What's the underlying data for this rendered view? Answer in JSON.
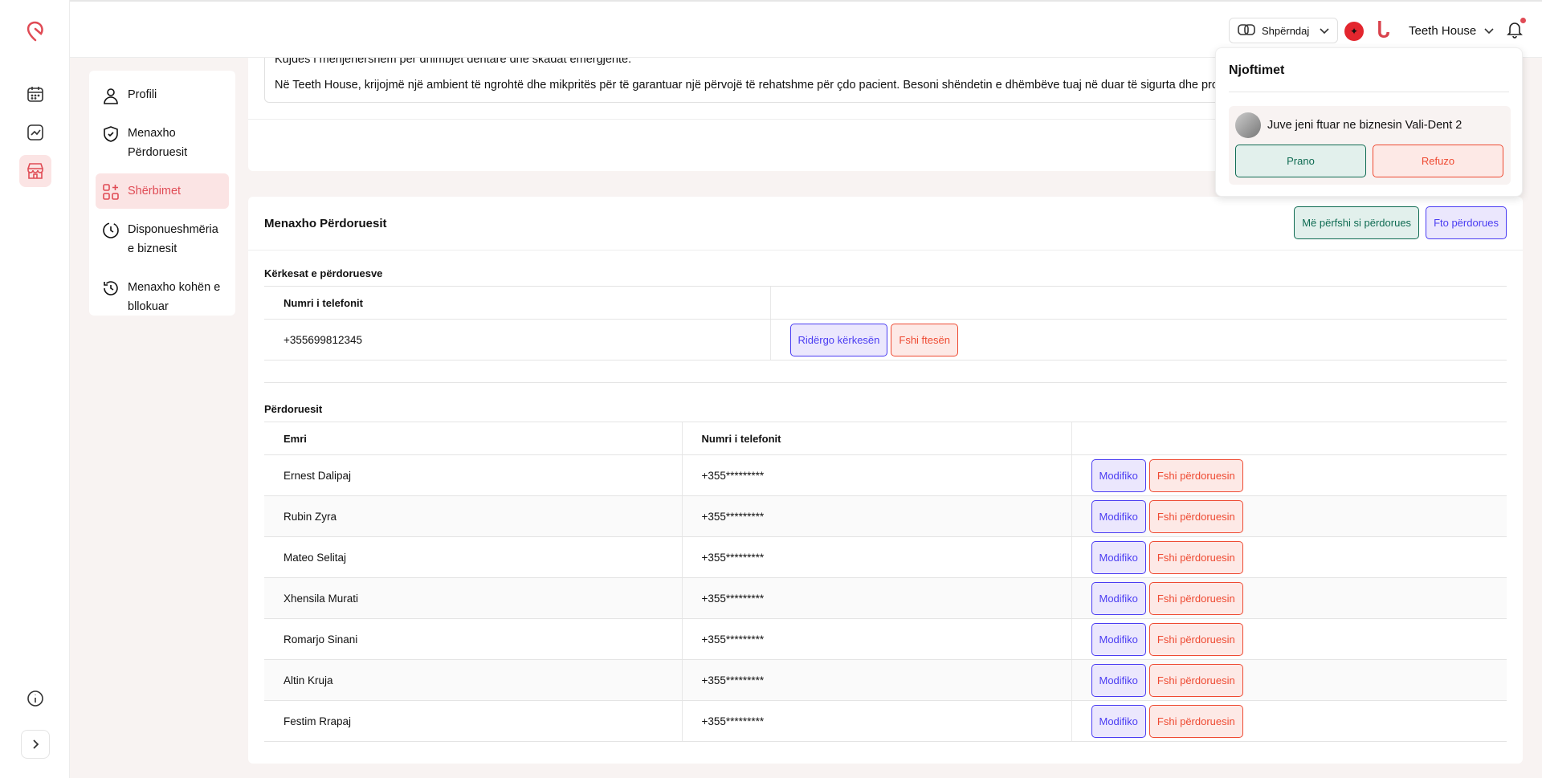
{
  "header": {
    "share_label": "Shpërndaj",
    "business_name": "Teeth House"
  },
  "rail": {
    "icons": [
      "calendar-icon",
      "chart-icon",
      "store-icon",
      "info-icon",
      "chevron-right-icon"
    ]
  },
  "menu": {
    "items": [
      {
        "label": "Profili"
      },
      {
        "label": "Menaxho Përdoruesit"
      },
      {
        "label": "Shërbimet",
        "active": true
      },
      {
        "label": "Disponueshmëria e biznesit"
      },
      {
        "label": "Menaxho kohën e bllokuar"
      }
    ]
  },
  "description": {
    "line1": "Kujdes i menjëhershëm për dhimbjet dentare dhe skadat emergjente.",
    "line2": "Në Teeth House, krijojmë një ambient të ngrohtë dhe mikpritës për të garantuar një përvojë të rehatshme për çdo pacient. Besoni shëndetin e dhëmbëve tuaj në duar të sigurta dhe profesionale!"
  },
  "users_card": {
    "title": "Menaxho Përdoruesit",
    "include_label": "Më përfshi si përdorues",
    "invite_label": "Fto përdorues",
    "requests": {
      "title": "Kërkesat e përdoruesve",
      "col_phone": "Numri i telefonit",
      "rows": [
        {
          "phone": "+355699812345",
          "resend": "Ridërgo kërkesën",
          "delete": "Fshi ftesën"
        }
      ]
    },
    "users": {
      "title": "Përdoruesit",
      "col_name": "Emri",
      "col_phone": "Numri i telefonit",
      "edit_label": "Modifiko",
      "delete_label": "Fshi përdoruesin",
      "rows": [
        {
          "name": "Ernest Dalipaj",
          "phone": "+355*********"
        },
        {
          "name": "Rubin Zyra",
          "phone": "+355*********"
        },
        {
          "name": "Mateo Selitaj",
          "phone": "+355*********"
        },
        {
          "name": "Xhensila Murati",
          "phone": "+355*********"
        },
        {
          "name": "Romarjo Sinani",
          "phone": "+355*********"
        },
        {
          "name": "Altin Kruja",
          "phone": "+355*********"
        },
        {
          "name": "Festim Rrapaj",
          "phone": "+355*********"
        }
      ]
    }
  },
  "notifications": {
    "title": "Njoftimet",
    "message": "Juve jeni ftuar ne biznesin Vali-Dent 2",
    "accept": "Prano",
    "decline": "Refuzo"
  },
  "colors": {
    "accent": "#e04b55",
    "green": "#0f6b52",
    "blue": "#4a3cf2",
    "red": "#ee4a32"
  }
}
